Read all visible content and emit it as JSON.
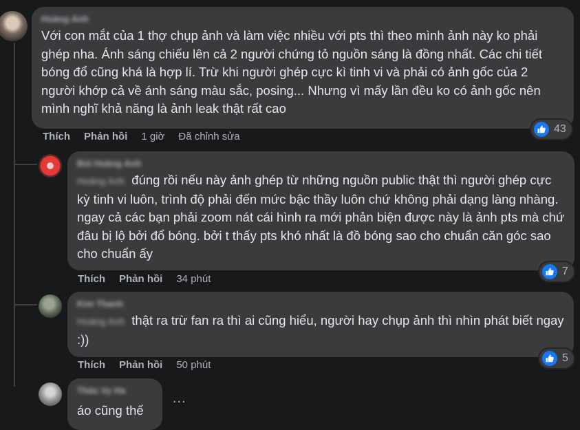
{
  "comments": [
    {
      "author": "Hoàng Anh",
      "mention": "",
      "text": "Với con mắt của 1 thợ chụp ảnh và làm việc nhiều với pts thì theo mình ảnh này ko phải ghép nha. Ánh sáng chiếu lên cả 2 người chứng tỏ nguồn sáng là đồng nhất. Các chi tiết bóng đổ cũng khá là hợp lí. Trừ khi người ghép cực kì tinh vi và phải có ảnh gốc của 2 người khớp cả về ánh sáng màu sắc, posing... Nhưng vì mấy lần đều ko có ảnh gốc nên mình nghĩ khả năng là ảnh leak thật rất cao",
      "like_label": "Thích",
      "reply_label": "Phản hồi",
      "time": "1 giờ",
      "edited": "Đã chỉnh sửa",
      "reactions": "43"
    },
    {
      "author": "Bùi Hoàng Anh",
      "mention": "Hoàng Anh",
      "text": "đúng rồi nếu này ảnh ghép từ những nguồn public thật thì người ghép cực kỳ tinh vi luôn, trình độ phải đến mức bậc thầy luôn chứ không phải dạng làng nhàng. ngay cả các bạn phải zoom nát cái hình ra mới phản biện được này là ảnh pts mà chứ đâu bị lộ bởi đổ bóng. bởi t thấy pts khó nhất là đồ bóng sao cho chuẩn căn góc sao cho chuẩn ấy",
      "like_label": "Thích",
      "reply_label": "Phản hồi",
      "time": "34 phút",
      "reactions": "7"
    },
    {
      "author": "Kim Thanh",
      "mention": "Hoàng Anh",
      "text": "thật ra trừ fan ra thì ai cũng hiểu, người hay chụp ảnh thì nhìn phát biết ngay :))",
      "like_label": "Thích",
      "reply_label": "Phản hồi",
      "time": "50 phút",
      "reactions": "5"
    },
    {
      "author": "Thảo Vy Ha",
      "mention": "",
      "text": "áo cũng thế",
      "more": "..."
    }
  ],
  "icons": {
    "like": "thumbs-up-icon",
    "more": "more-options-icon"
  },
  "colors": {
    "background": "#18191a",
    "bubble": "#3a3b3c",
    "like_badge": "#1877f2",
    "muted": "#b0b3b8",
    "text": "#e4e6eb"
  }
}
